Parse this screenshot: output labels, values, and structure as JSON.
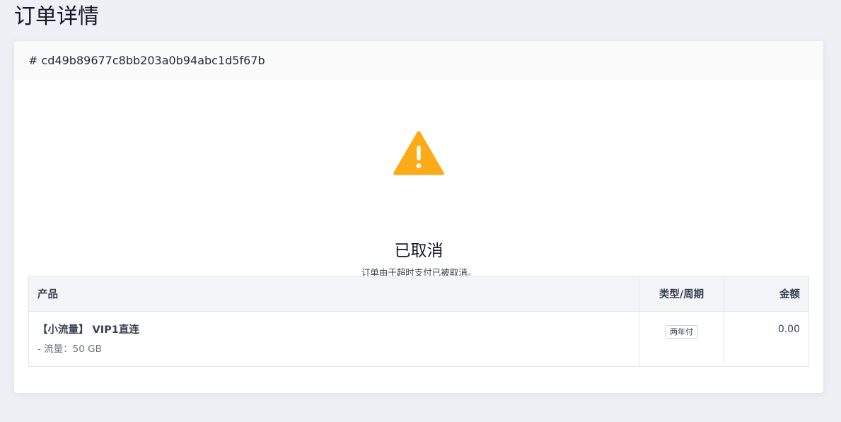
{
  "page": {
    "title": "订单详情"
  },
  "order": {
    "id_text": "# cd49b89677c8bb203a0b94abc1d5f67b"
  },
  "status": {
    "icon": "warning-triangle-icon",
    "title": "已取消",
    "description": "订单由于超时支付已被取消。",
    "icon_color": "#fbab18"
  },
  "table": {
    "headers": {
      "product": "产品",
      "type_period": "类型/周期",
      "amount": "金额"
    },
    "rows": [
      {
        "product_name": "【小流量】 VIP1直连",
        "product_detail": "- 流量：50 GB",
        "period": "两年付",
        "amount": "0.00"
      }
    ]
  }
}
